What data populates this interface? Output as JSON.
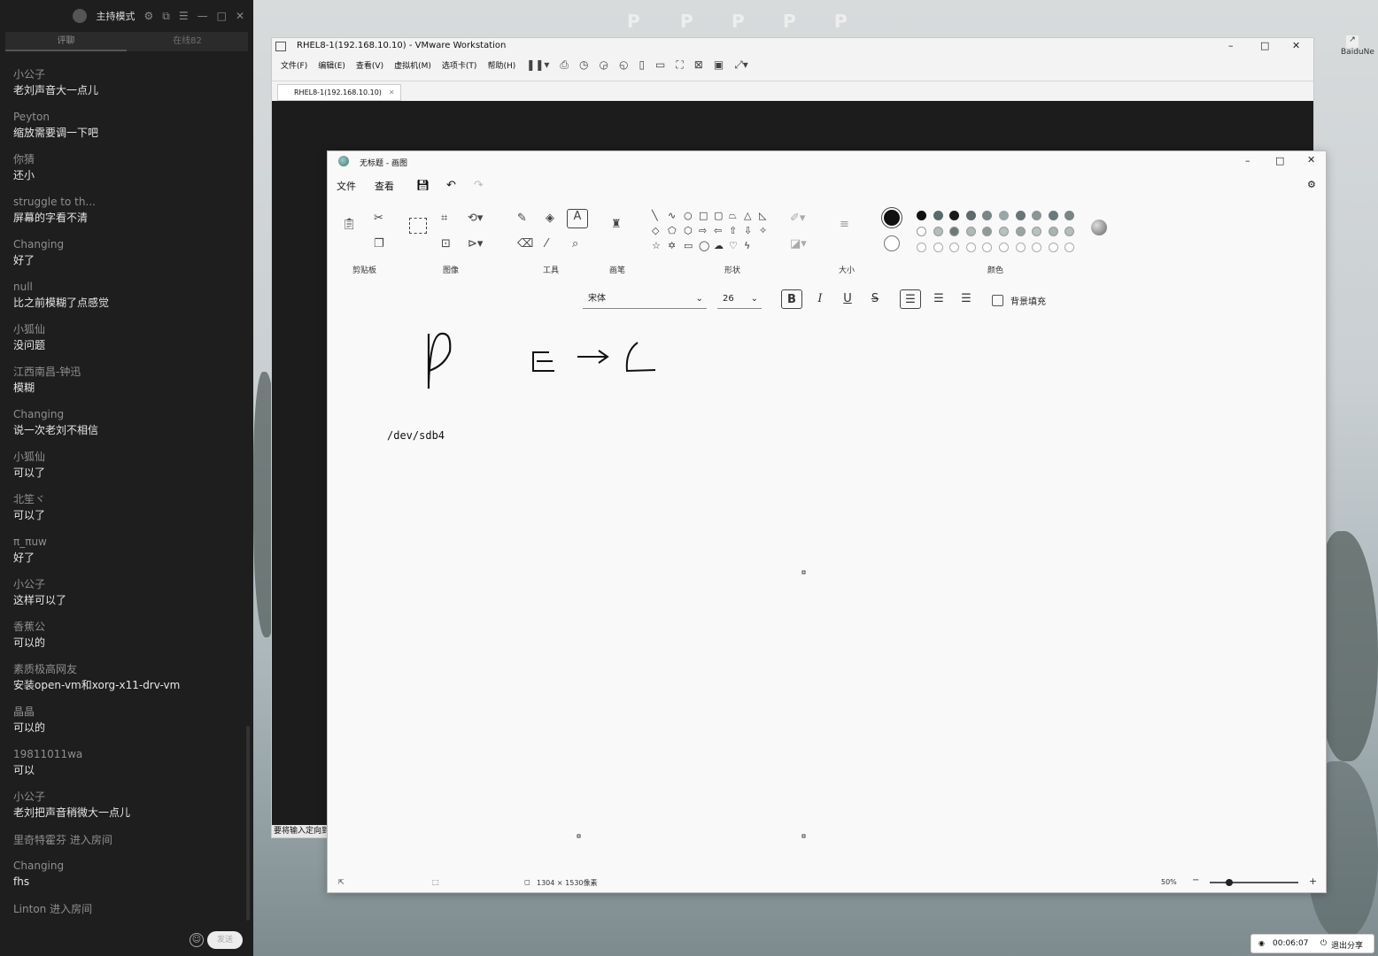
{
  "chat": {
    "mode_label": "主持模式",
    "tabs": [
      "评聊",
      "在线82"
    ],
    "messages": [
      {
        "user": "小公子",
        "text": "老刘声音大一点儿"
      },
      {
        "user": "Peyton",
        "text": "缩放需要调一下吧"
      },
      {
        "user": "你猜",
        "text": "还小"
      },
      {
        "user": "struggle to th...",
        "text": "屏幕的字看不清"
      },
      {
        "user": "Changing",
        "text": "好了"
      },
      {
        "user": "null",
        "text": "比之前模糊了点感觉"
      },
      {
        "user": "小狐仙",
        "text": "没问题"
      },
      {
        "user": "江西南昌-钟迅",
        "text": "模糊"
      },
      {
        "user": "Changing",
        "text": "说一次老刘不相信"
      },
      {
        "user": "小狐仙",
        "text": "可以了"
      },
      {
        "user": "北笙ヾ",
        "text": "可以了"
      },
      {
        "user": "π_πuw",
        "text": "好了"
      },
      {
        "user": "小公子",
        "text": "这样可以了"
      },
      {
        "user": "香蕉公",
        "text": "可以的"
      },
      {
        "user": "素质极高网友",
        "text": "安装open-vm和xorg-x11-drv-vm"
      },
      {
        "user": "晶晶",
        "text": "可以的"
      },
      {
        "user": "19811011wa",
        "text": "可以"
      },
      {
        "user": "小公子",
        "text": "老刘把声音稍微大一点儿"
      }
    ],
    "system1": "里奇特霍芬 进入房间",
    "last_message": {
      "user": "Changing",
      "text": "fhs"
    },
    "system2": "Linton 进入房间",
    "send_label": "发送"
  },
  "vmware": {
    "title": "RHEL8-1(192.168.10.10) - VMware Workstation",
    "menu": [
      "文件(F)",
      "编辑(E)",
      "查看(V)",
      "虚拟机(M)",
      "选项卡(T)",
      "帮助(H)"
    ],
    "tab": "RHEL8-1(192.168.10.10)",
    "status": "要将输入定向到"
  },
  "paint": {
    "title": "无标题 - 画图",
    "menu": [
      "文件",
      "查看"
    ],
    "groups": [
      "剪贴板",
      "图像",
      "工具",
      "画笔",
      "形状",
      "大小",
      "颜色"
    ],
    "font": "宋体",
    "size": "26",
    "bg_fill_label": "背景填充",
    "canvas_text": "/dev/sdb4",
    "dimensions": "1304 × 1530像素",
    "zoom": "50%",
    "palette_row1": [
      "#111111",
      "#5a6a6a",
      "#1a1a1a",
      "#606a6a",
      "#7a8585",
      "#9aa5a5",
      "#6a7575",
      "#8a9595",
      "#6a7a7a",
      "#7a8585"
    ],
    "palette_row2": [
      "#ffffff",
      "#b5bcbc",
      "#6e7878",
      "#b0b8b8",
      "#909a9a",
      "#b8c0c0",
      "#9aa4a4",
      "#b8c0c0",
      "#aab2b2",
      "#b5bcbc"
    ]
  },
  "desktop": {
    "baidu_label": "BaiduNe",
    "share_time": "00:06:07",
    "share_exit": "退出分享"
  }
}
